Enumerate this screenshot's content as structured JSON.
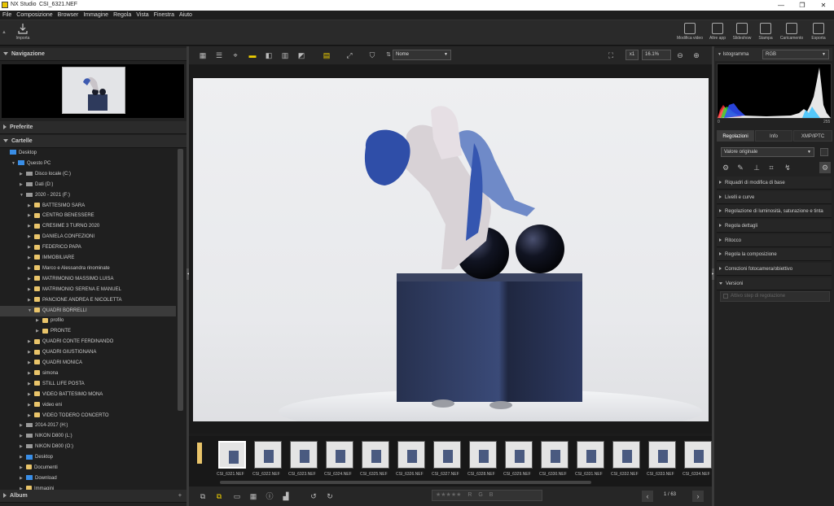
{
  "window": {
    "app": "NX Studio",
    "file": "CSI_6321.NEF",
    "controls": [
      "—",
      "❐",
      "✕"
    ]
  },
  "menu": [
    "File",
    "Composizione",
    "Browser",
    "Immagine",
    "Regola",
    "Vista",
    "Finestra",
    "Aiuto"
  ],
  "toolbar": {
    "import_label": "Importa",
    "right": [
      {
        "label": "Modifica video",
        "icon": "video-edit-icon"
      },
      {
        "label": "Altre app",
        "icon": "apps-icon"
      },
      {
        "label": "Slideshow",
        "icon": "slideshow-icon"
      },
      {
        "label": "Stampa",
        "icon": "print-icon"
      },
      {
        "label": "Caricamento",
        "icon": "upload-icon"
      },
      {
        "label": "Esporta",
        "icon": "export-icon"
      }
    ]
  },
  "left": {
    "navigation_title": "Navigazione",
    "favorites_title": "Preferite",
    "folders_title": "Cartelle",
    "album_title": "Album",
    "tree": [
      {
        "label": "Desktop",
        "level": 0,
        "kind": "pc",
        "arrow": ""
      },
      {
        "label": "Questo PC",
        "level": 1,
        "kind": "pc",
        "arrow": "▼"
      },
      {
        "label": "Disco locale (C:)",
        "level": 2,
        "kind": "drive",
        "arrow": "▶"
      },
      {
        "label": "Dati (D:)",
        "level": 2,
        "kind": "drive",
        "arrow": "▶"
      },
      {
        "label": "2020 - 2021 (F:)",
        "level": 2,
        "kind": "drive",
        "arrow": "▼"
      },
      {
        "label": "BATTESIMO SARA",
        "level": 3,
        "kind": "folder",
        "arrow": "▶"
      },
      {
        "label": "CENTRO BENESSERE",
        "level": 3,
        "kind": "folder",
        "arrow": "▶"
      },
      {
        "label": "CRESIME 3 TURNO 2020",
        "level": 3,
        "kind": "folder",
        "arrow": "▶"
      },
      {
        "label": "DANIELA CONFEZIONI",
        "level": 3,
        "kind": "folder",
        "arrow": "▶"
      },
      {
        "label": "FEDERICO PAPA",
        "level": 3,
        "kind": "folder",
        "arrow": "▶"
      },
      {
        "label": "IMMOBILIARE",
        "level": 3,
        "kind": "folder",
        "arrow": "▶"
      },
      {
        "label": "Marco e Alessandra rinominate",
        "level": 3,
        "kind": "folder",
        "arrow": "▶"
      },
      {
        "label": "MATRIMONIO MASSIMO LUISA",
        "level": 3,
        "kind": "folder",
        "arrow": "▶"
      },
      {
        "label": "MATRIMONIO SERENA E MANUEL",
        "level": 3,
        "kind": "folder",
        "arrow": "▶"
      },
      {
        "label": "PANCIONE ANDREA E NICOLETTA",
        "level": 3,
        "kind": "folder",
        "arrow": "▶"
      },
      {
        "label": "QUADRI BORRELLI",
        "level": 3,
        "kind": "folder",
        "arrow": "▼",
        "selected": true
      },
      {
        "label": "profilo",
        "level": 4,
        "kind": "folder",
        "arrow": "▶"
      },
      {
        "label": "PRONTE",
        "level": 4,
        "kind": "folder",
        "arrow": "▶"
      },
      {
        "label": "QUADRI CONTE FERDINANDO",
        "level": 3,
        "kind": "folder",
        "arrow": "▶"
      },
      {
        "label": "QUADRI GIUSTIGNANA",
        "level": 3,
        "kind": "folder",
        "arrow": "▶"
      },
      {
        "label": "QUADRI MONICA",
        "level": 3,
        "kind": "folder",
        "arrow": "▶"
      },
      {
        "label": "simona",
        "level": 3,
        "kind": "folder",
        "arrow": "▶"
      },
      {
        "label": "STILL LIFE POSTA",
        "level": 3,
        "kind": "folder",
        "arrow": "▶"
      },
      {
        "label": "VIDEO BATTESIMO MONA",
        "level": 3,
        "kind": "folder",
        "arrow": "▶"
      },
      {
        "label": "video eni",
        "level": 3,
        "kind": "folder",
        "arrow": "▶"
      },
      {
        "label": "VIDEO TODERO CONCERTO",
        "level": 3,
        "kind": "folder",
        "arrow": "▶"
      },
      {
        "label": "2014-2017 (H:)",
        "level": 2,
        "kind": "drive",
        "arrow": "▶"
      },
      {
        "label": "NIKON D800 (L:)",
        "level": 2,
        "kind": "drive",
        "arrow": "▶"
      },
      {
        "label": "NIKON D800  (O:)",
        "level": 2,
        "kind": "drive",
        "arrow": "▶"
      },
      {
        "label": "Desktop",
        "level": 2,
        "kind": "pc",
        "arrow": "▶"
      },
      {
        "label": "Documenti",
        "level": 2,
        "kind": "folder",
        "arrow": "▶"
      },
      {
        "label": "Download",
        "level": 2,
        "kind": "pc",
        "arrow": "▶"
      },
      {
        "label": "Immagini",
        "level": 2,
        "kind": "folder",
        "arrow": "▶"
      }
    ]
  },
  "center": {
    "sort_label": "Nome",
    "zoom_mult": "x1",
    "zoom": "16.1%",
    "page": "1 / 63",
    "filmstrip": [
      "CSI_6321.NEF",
      "CSI_6322.NEF",
      "CSI_6323.NEF",
      "CSI_6324.NEF",
      "CSI_6325.NEF",
      "CSI_6326.NEF",
      "CSI_6327.NEF",
      "CSI_6328.NEF",
      "CSI_6329.NEF",
      "CSI_6330.NEF",
      "CSI_6331.NEF",
      "CSI_6332.NEF",
      "CSI_6333.NEF",
      "CSI_6334.NEF"
    ],
    "rating": "★★★★★",
    "color_labels": [
      "R",
      "G",
      "B"
    ]
  },
  "right": {
    "histogram_title": "Istogramma",
    "histogram_channel": "RGB",
    "hist_min": "0",
    "hist_max": "255",
    "tabs": [
      "Regolazioni",
      "Info",
      "XMP/IPTC"
    ],
    "preset": "Valore originale",
    "sections": [
      "Riquadri di modifica di base",
      "Livelli e curve",
      "Regolazione di luminosità, saturazione e tinta",
      "Regola dettagli",
      "Ritocco",
      "Regola la composizione",
      "Correzioni fotocamera/obiettivo",
      "Versioni"
    ],
    "versions_placeholder": "Attivo step di regolazione"
  }
}
